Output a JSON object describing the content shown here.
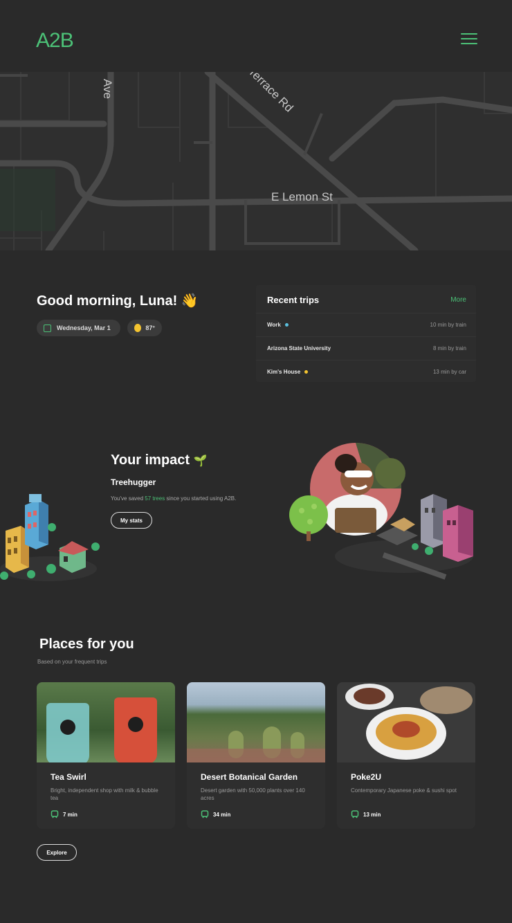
{
  "header": {
    "logo": "A2B",
    "menu_icon": "hamburger-icon"
  },
  "map": {
    "streets": [
      "Ave",
      "Terrace Rd",
      "E Lemon St"
    ]
  },
  "greeting": {
    "title": "Good morning, Luna! 👋",
    "date": "Wednesday, Mar 1",
    "temperature": "87°"
  },
  "recent_trips": {
    "title": "Recent trips",
    "more": "More",
    "items": [
      {
        "name": "Work",
        "duration": "10 min by train",
        "dot_color": "#5bc0de"
      },
      {
        "name": "Arizona State University",
        "duration": "8 min by train",
        "dot_color": ""
      },
      {
        "name": "Kim's House",
        "duration": "13 min by car",
        "dot_color": "#f4c430"
      }
    ]
  },
  "impact": {
    "title": "Your impact",
    "subtitle": "Treehugger",
    "text_prefix": "You've saved ",
    "text_highlight": "57 trees",
    "text_suffix": " since you started using A2B.",
    "button": "My stats"
  },
  "places": {
    "title": "Places for you",
    "subtitle": "Based on your frequent trips",
    "cards": [
      {
        "title": "Tea Swirl",
        "description": "Bright, independent shop with milk & bubble tea",
        "time": "7 min"
      },
      {
        "title": "Desert Botanical Garden",
        "description": "Desert garden with 50,000 plants over 140 acres",
        "time": "34 min"
      },
      {
        "title": "Poke2U",
        "description": "Contemporary Japanese poke & sushi spot",
        "time": "13 min"
      }
    ],
    "button": "Explore"
  },
  "colors": {
    "accent": "#4cc177",
    "background": "#2a2a2a"
  }
}
